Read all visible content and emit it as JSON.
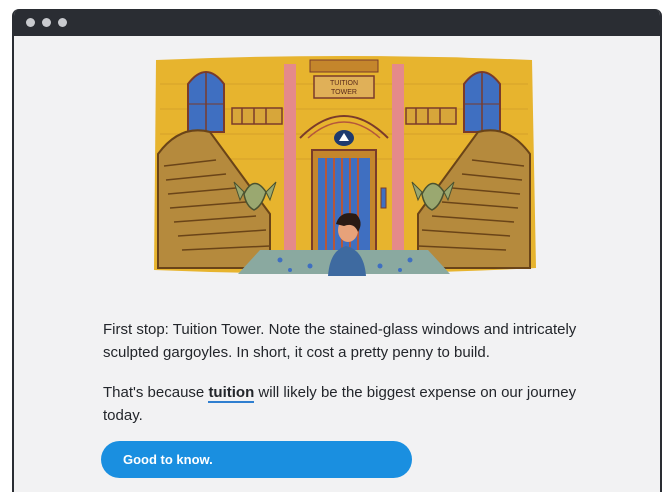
{
  "window": {
    "controls": [
      "window-dot",
      "window-dot",
      "window-dot"
    ]
  },
  "illustration": {
    "sign_line1": "TUITION",
    "sign_line2": "TOWER"
  },
  "paragraph1": "First stop: Tuition Tower. Note the stained-glass windows and intricately sculpted gargoyles. In short, it cost a pretty penny to build.",
  "paragraph2": {
    "before": "That's because ",
    "term": "tuition",
    "after": " will likely be the biggest expense on our journey today."
  },
  "cta_label": "Good to know.",
  "colors": {
    "titlebar": "#2a2d33",
    "background": "#f2f2f3",
    "button": "#1a8fe0",
    "illustration_yellow": "#e7b42e",
    "stairs": "#b58a3d",
    "stained_glass": "#3f6fc1",
    "floor": "#8aa9a0"
  }
}
